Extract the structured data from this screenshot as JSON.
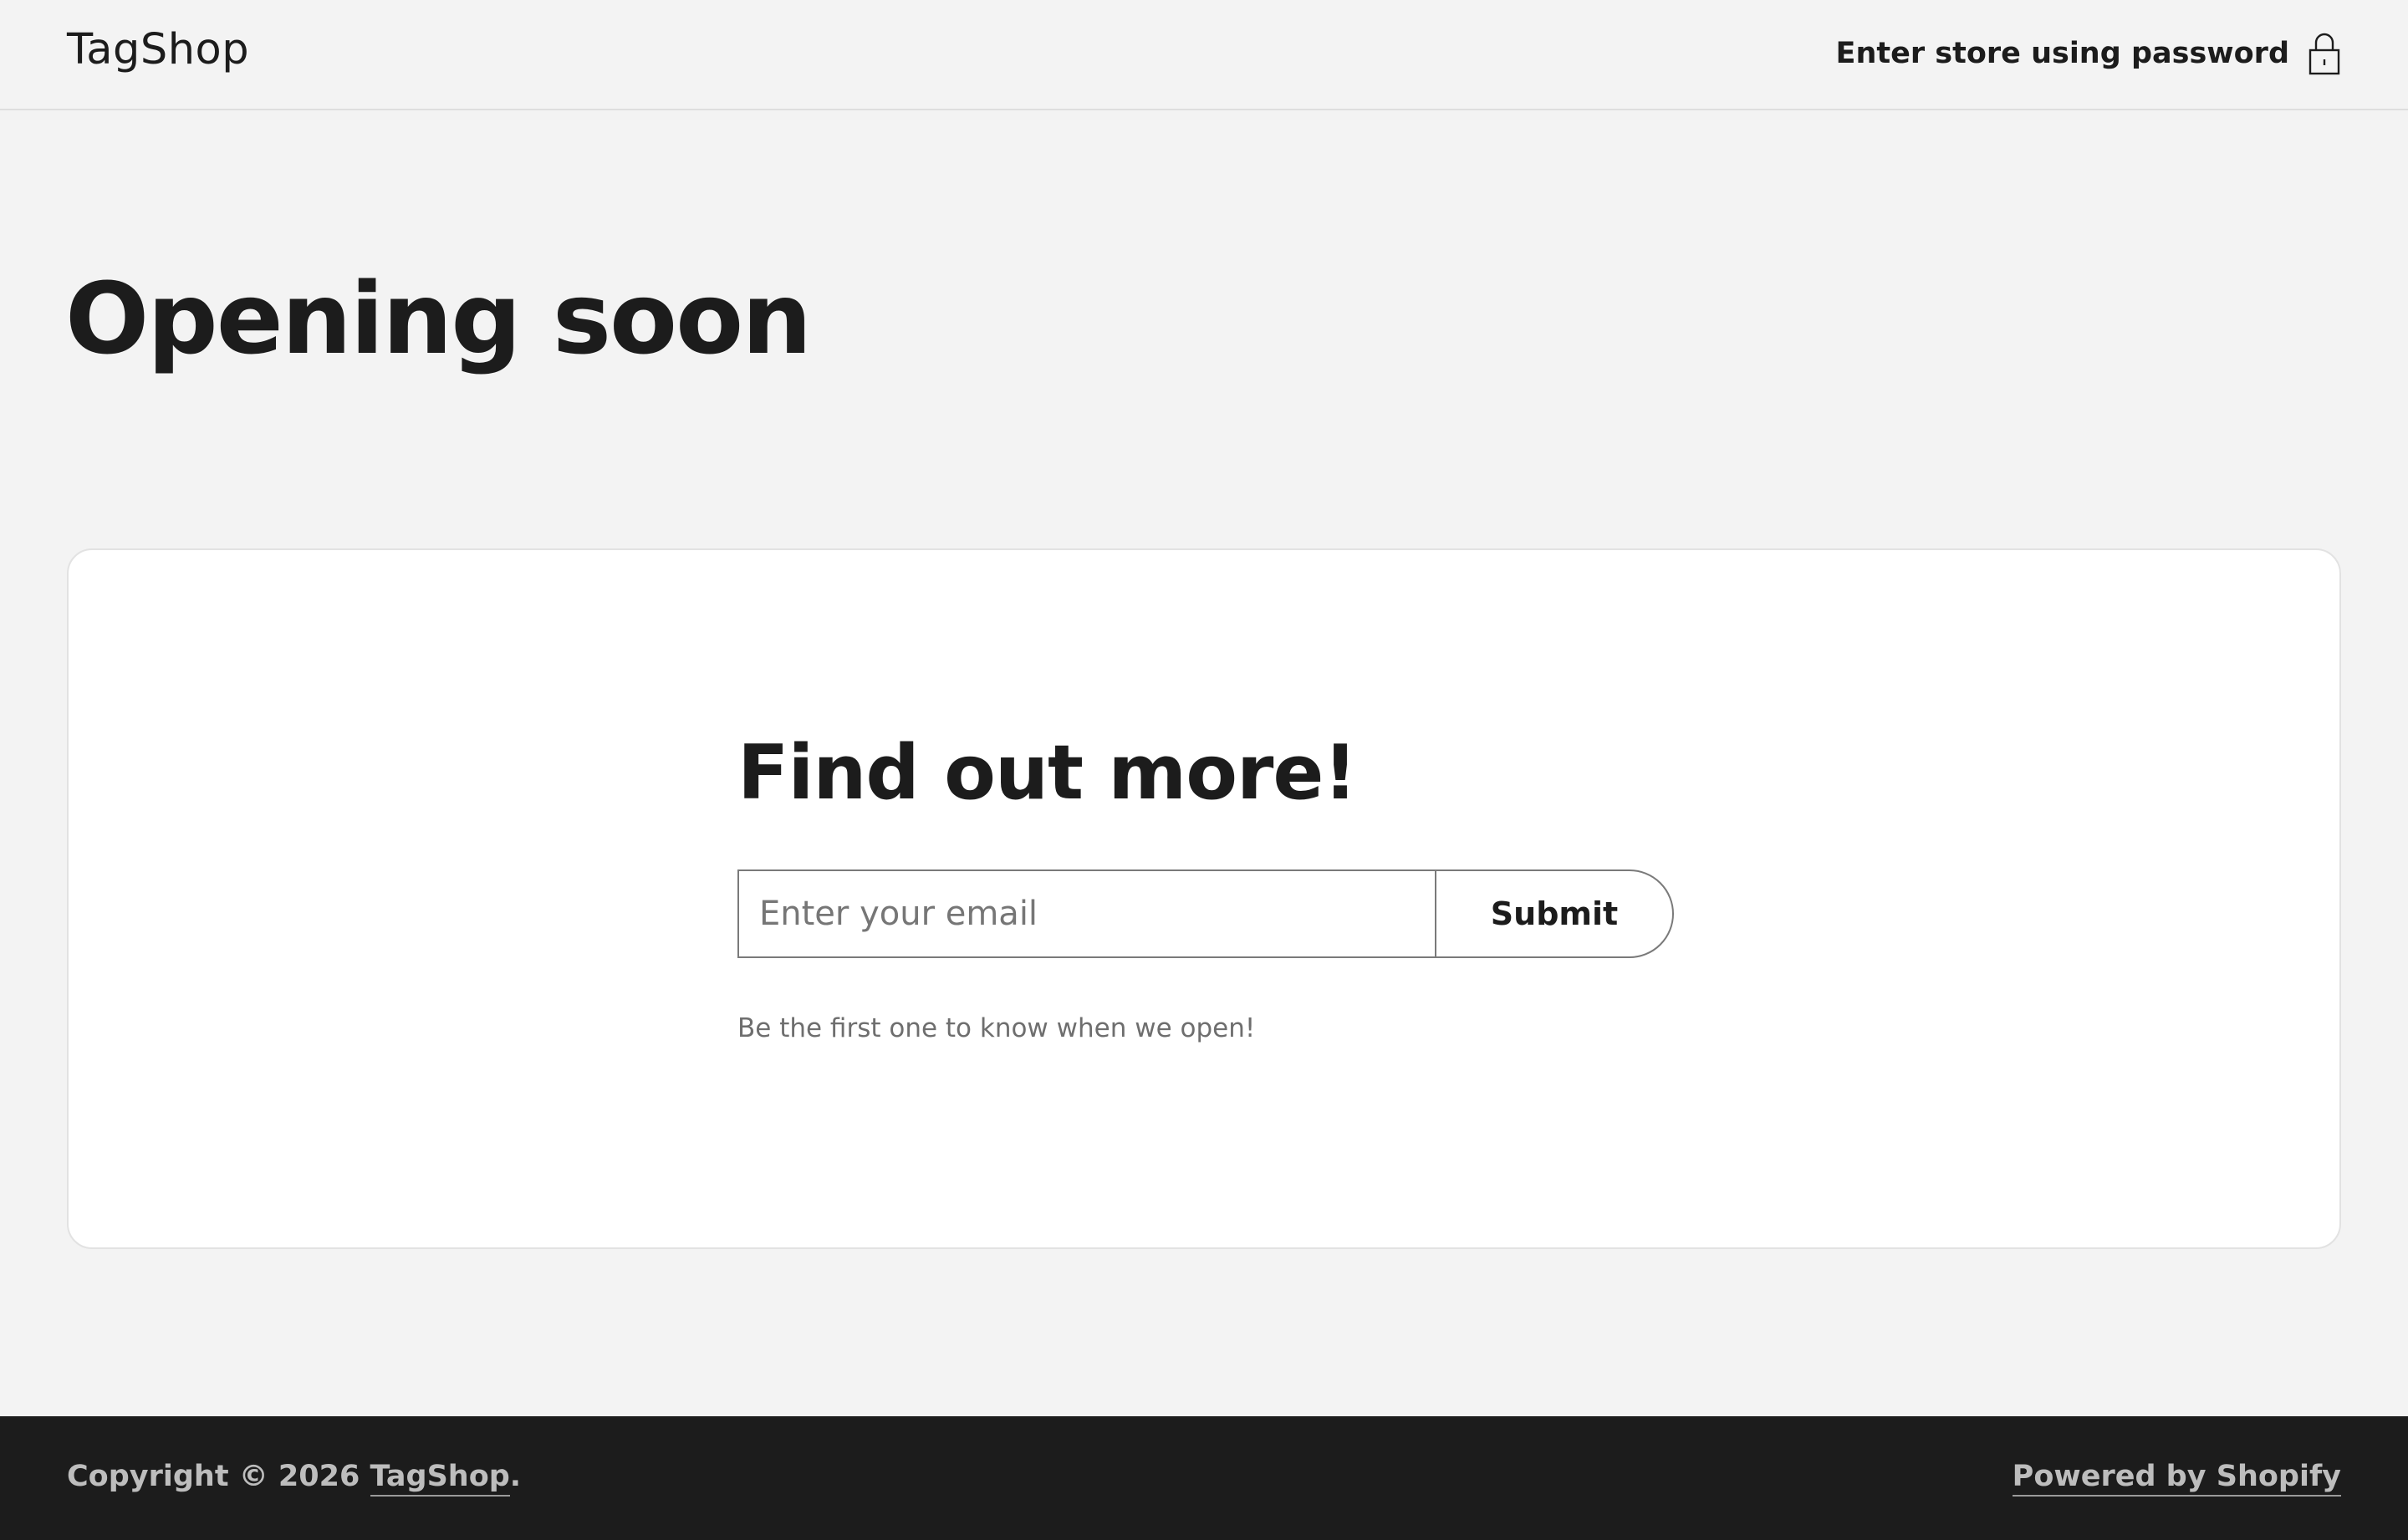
{
  "header": {
    "brand": "TagShop",
    "enter_password_label": "Enter store using password",
    "lock_icon": "lock-icon"
  },
  "main": {
    "title": "Opening soon",
    "card": {
      "heading": "Find out more!",
      "email_placeholder": "Enter your email",
      "email_value": "",
      "submit_label": "Submit",
      "note": "Be the first one to know when we open!"
    }
  },
  "footer": {
    "copyright_prefix": "Copyright © 2026 ",
    "copyright_brand": "TagShop",
    "copyright_suffix": ".",
    "powered_by": "Powered by Shopify"
  },
  "colors": {
    "background": "#f3f3f3",
    "card": "#ffffff",
    "text": "#1c1c1c",
    "muted": "#6e6e6e",
    "footer": "#1c1c1c"
  }
}
